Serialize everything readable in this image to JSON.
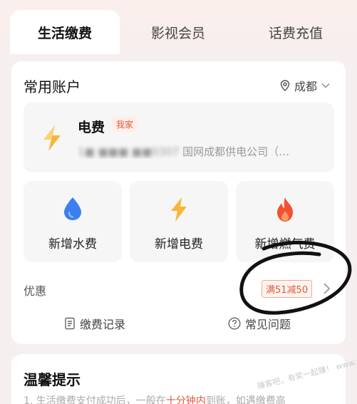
{
  "tabs": [
    {
      "label": "生活缴费",
      "active": true
    },
    {
      "label": "影视会员",
      "active": false
    },
    {
      "label": "话费充值",
      "active": false
    }
  ],
  "accounts": {
    "title": "常用账户",
    "city": "成都",
    "city_icon": "location-pin-icon",
    "bill": {
      "name": "电费",
      "badge": "我家",
      "account_masked": "1■ ■■■ ■■0307",
      "company": "国网成都供电公司（…"
    },
    "tiles": [
      {
        "label": "新增水费",
        "icon": "water-drop-icon"
      },
      {
        "label": "新增电费",
        "icon": "lightning-icon"
      },
      {
        "label": "新增燃气费",
        "icon": "flame-icon"
      }
    ],
    "promo": {
      "label": "优惠",
      "tag": "满51减50"
    },
    "links": [
      {
        "label": "缴费记录",
        "icon": "receipt-icon"
      },
      {
        "label": "常见问题",
        "icon": "question-icon"
      }
    ]
  },
  "tips": {
    "title": "温馨提示",
    "line_prefix": "1. 生活缴费支付成功后，一般在",
    "line_highlight": "十分钟内",
    "line_suffix": "到账，如遇缴费高"
  },
  "watermark": "赚客吧，有奖一起赚！ www.zuanke8.com",
  "colors": {
    "accent": "#e4583b",
    "water": "#3d7ff0",
    "electric": "#f7b733",
    "gas": "#f2532e"
  }
}
